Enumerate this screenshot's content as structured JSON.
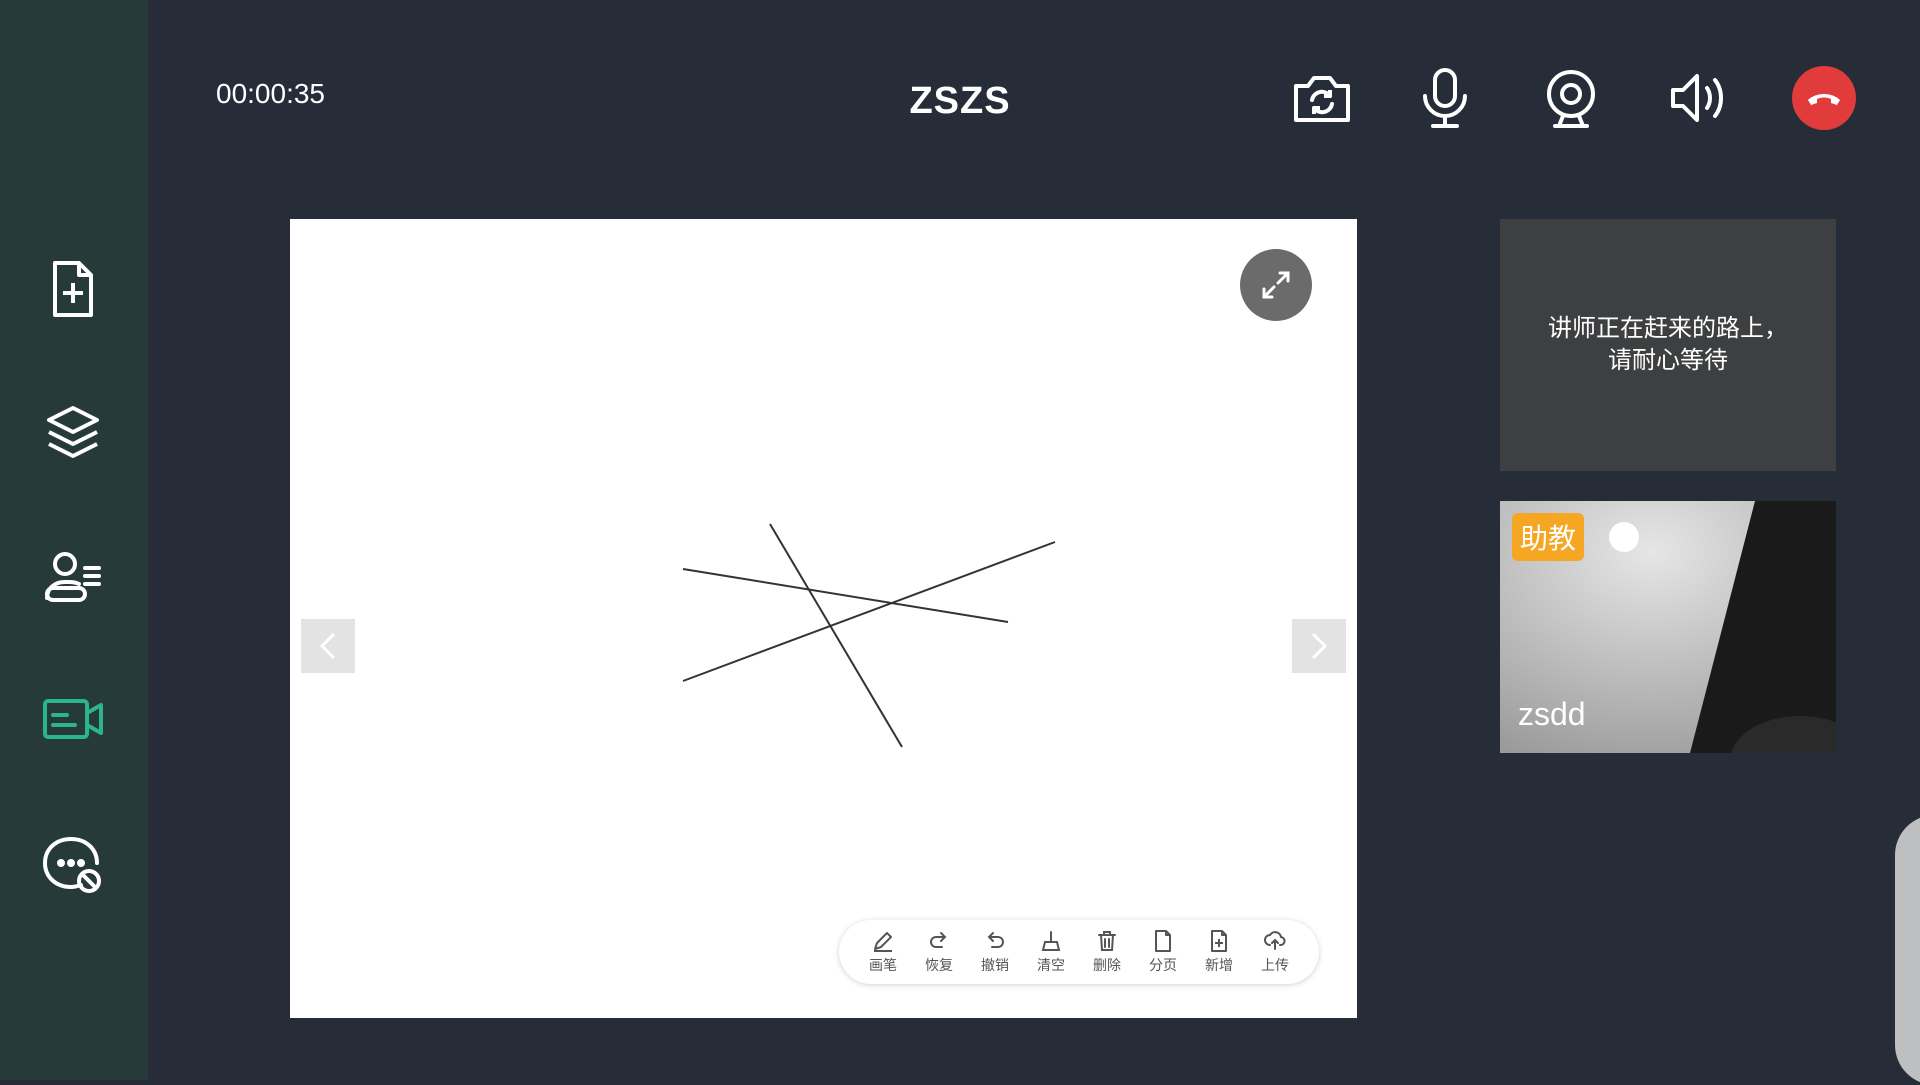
{
  "header": {
    "timer": "00:00:35",
    "title": "ZSZS",
    "controls": [
      {
        "name": "switch-camera-icon"
      },
      {
        "name": "microphone-icon"
      },
      {
        "name": "webcam-icon"
      },
      {
        "name": "speaker-icon"
      },
      {
        "name": "hangup-icon",
        "color": "#e23b3b"
      }
    ]
  },
  "sidebar": {
    "items": [
      {
        "name": "add-document-icon"
      },
      {
        "name": "layers-icon"
      },
      {
        "name": "members-icon"
      },
      {
        "name": "video-course-icon",
        "active": true,
        "color": "#2bb58a"
      },
      {
        "name": "chat-disabled-icon"
      }
    ]
  },
  "whiteboard": {
    "toolbar": [
      {
        "label": "画笔",
        "icon": "pen-icon"
      },
      {
        "label": "恢复",
        "icon": "redo-icon"
      },
      {
        "label": "撤销",
        "icon": "undo-icon"
      },
      {
        "label": "清空",
        "icon": "clear-icon"
      },
      {
        "label": "删除",
        "icon": "trash-icon"
      },
      {
        "label": "分页",
        "icon": "page-icon"
      },
      {
        "label": "新增",
        "icon": "add-page-icon"
      },
      {
        "label": "上传",
        "icon": "upload-icon"
      }
    ]
  },
  "teacher_tile": {
    "waiting_line1": "讲师正在赶来的路上，",
    "waiting_line2": "请耐心等待"
  },
  "assistant_tile": {
    "badge": "助教",
    "name": "zsdd"
  }
}
